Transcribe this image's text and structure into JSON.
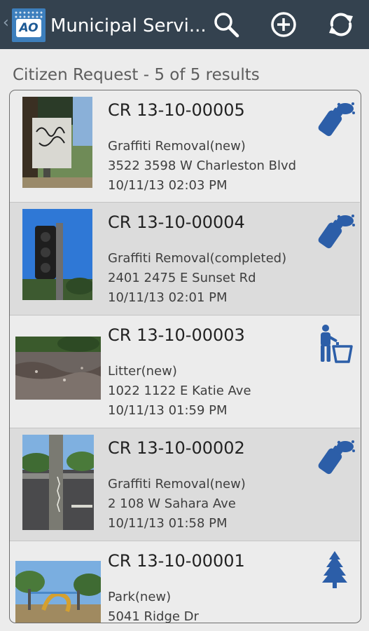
{
  "app": {
    "title": "Municipal Servi...",
    "logo_text": "AO"
  },
  "toolbar": {
    "search_icon": "search-icon",
    "add_icon": "add-circle-icon",
    "refresh_icon": "refresh-icon"
  },
  "results": {
    "header": "Citizen Request - 5 of 5 results"
  },
  "colors": {
    "action_bar": "#34424f",
    "icon_blue": "#2c5ea8",
    "selected_row": "#dcdcdc"
  },
  "requests": [
    {
      "id": "CR 13-10-00005",
      "type_status": "Graffiti Removal(new)",
      "address": "3522 3598 W Charleston Blvd",
      "datetime": "10/11/13 02:03 PM",
      "icon": "spray-can-icon"
    },
    {
      "id": "CR 13-10-00004",
      "type_status": "Graffiti Removal(completed)",
      "address": "2401 2475 E Sunset Rd",
      "datetime": "10/11/13 02:01 PM",
      "icon": "spray-can-icon"
    },
    {
      "id": "CR 13-10-00003",
      "type_status": "Litter(new)",
      "address": "1022 1122 E Katie Ave",
      "datetime": "10/11/13 01:59 PM",
      "icon": "litter-bin-icon"
    },
    {
      "id": "CR 13-10-00002",
      "type_status": "Graffiti Removal(new)",
      "address": "2 108 W Sahara Ave",
      "datetime": "10/11/13 01:58 PM",
      "icon": "spray-can-icon"
    },
    {
      "id": "CR 13-10-00001",
      "type_status": "Park(new)",
      "address": "5041 Ridge Dr",
      "datetime": "",
      "icon": "tree-icon"
    }
  ]
}
